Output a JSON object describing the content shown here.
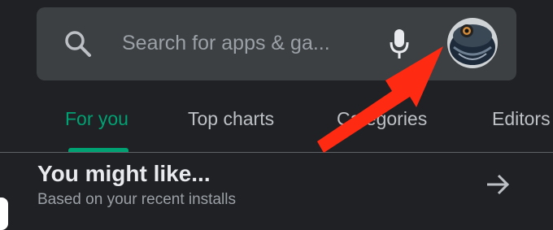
{
  "search": {
    "placeholder": "Search for apps & ga..."
  },
  "tabs": [
    {
      "label": "For you",
      "active": true
    },
    {
      "label": "Top charts",
      "active": false
    },
    {
      "label": "Categories",
      "active": false
    },
    {
      "label": "Editors",
      "active": false
    }
  ],
  "section": {
    "title": "You might like...",
    "subtitle": "Based on your recent installs"
  },
  "icons": {
    "search": "search-icon",
    "mic": "microphone-icon",
    "avatar": "account-avatar",
    "more": "arrow-right-icon"
  },
  "colors": {
    "background": "#202124",
    "search_bar": "#3c4043",
    "accent": "#00a173",
    "annotation": "#ff2a12"
  }
}
